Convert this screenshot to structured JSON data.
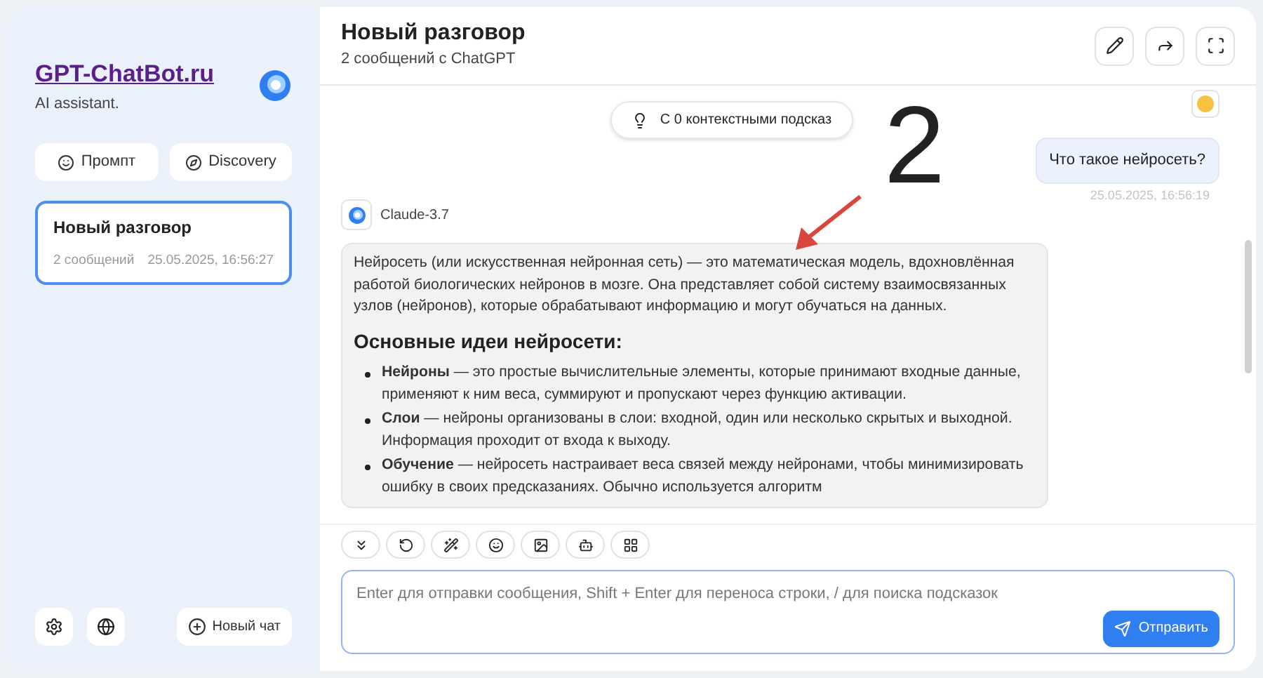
{
  "sidebar": {
    "brand": {
      "title": "GPT-ChatBot.ru",
      "subtitle": "AI assistant."
    },
    "buttons": [
      {
        "kind": "prompt",
        "label": "Промпт"
      },
      {
        "kind": "discovery",
        "label": "Discovery"
      }
    ],
    "conversations": [
      {
        "title": "Новый разговор",
        "count": "2 сообщений",
        "time": "25.05.2025, 16:56:27",
        "selected": true
      }
    ],
    "new_chat": "Новый чат"
  },
  "header": {
    "title": "Новый разговор",
    "subtitle": "2 сообщений с ChatGPT"
  },
  "context_pill": "С 0 контекстными подсказ",
  "user_message": {
    "text": "Что такое нейросеть?",
    "time": "25.05.2025, 16:56:19"
  },
  "assistant_message": {
    "model": "Claude-3.7",
    "intro": "Нейросеть (или искусственная нейронная сеть) — это математическая модель, вдохновлённая работой биологических нейронов в мозге. Она представляет собой систему взаимосвязанных узлов (нейронов), которые обрабатывают информацию и могут обучаться на данных.",
    "heading": "Основные идеи нейросети:",
    "bullets": [
      "**Нейроны** — это простые вычислительные элементы, которые принимают входные данные, применяют к ним веса, суммируют и пропускают через функцию активации.",
      "**Слои** — нейроны организованы в слои: входной, один или несколько скрытых и выходной. Информация проходит от входа к выходу.",
      "**Обучение** — нейросеть настраивает веса связей между нейронами, чтобы минимизировать ошибку в своих предсказаниях. Обычно используется алгоритм"
    ]
  },
  "composer": {
    "placeholder": "Enter для отправки сообщения, Shift + Enter для переноса строки, / для поиска подсказок",
    "send": "Отправить"
  },
  "annotation": {
    "label": "2"
  }
}
